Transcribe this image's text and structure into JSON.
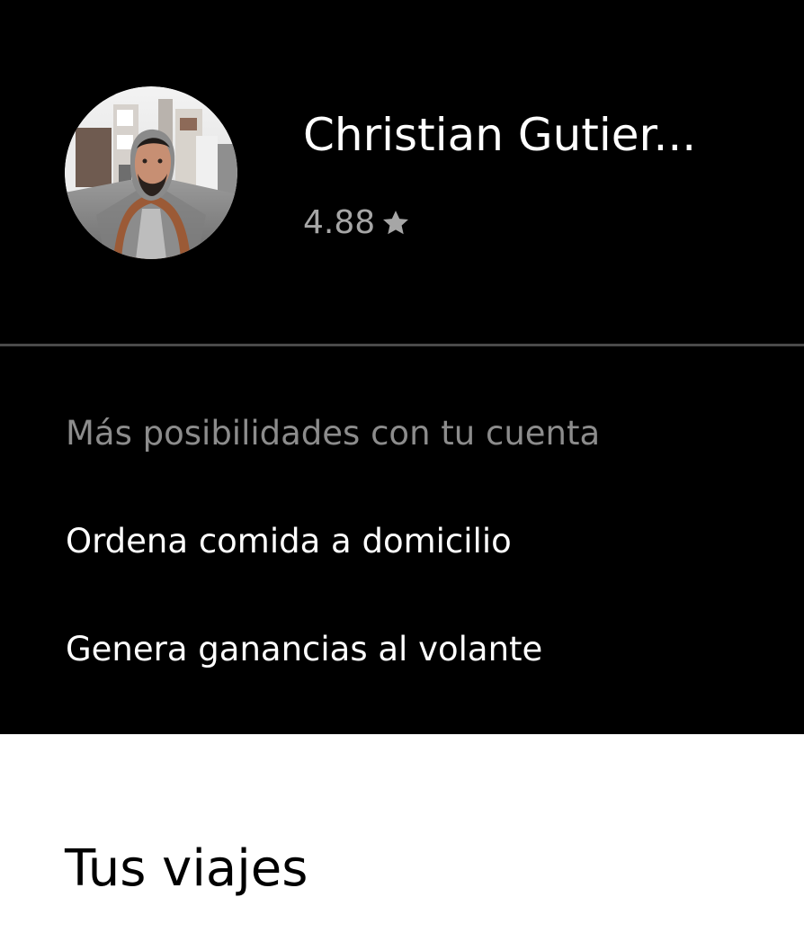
{
  "profile": {
    "name": "Christian Gutier...",
    "rating": "4.88",
    "rating_icon": "star-icon",
    "avatar_alt": "avatar"
  },
  "account_section": {
    "title": "Más posibilidades con tu cuenta",
    "items": [
      {
        "label": "Ordena comida a domicilio"
      },
      {
        "label": "Genera ganancias al volante"
      }
    ]
  },
  "trips": {
    "title": "Tus viajes"
  },
  "colors": {
    "dark_background": "#000000",
    "light_background": "#ffffff",
    "primary_text_dark": "#ffffff",
    "secondary_text": "#8c8c8c",
    "rating_text": "#a6a6a6",
    "divider": "#4a4a4a"
  }
}
